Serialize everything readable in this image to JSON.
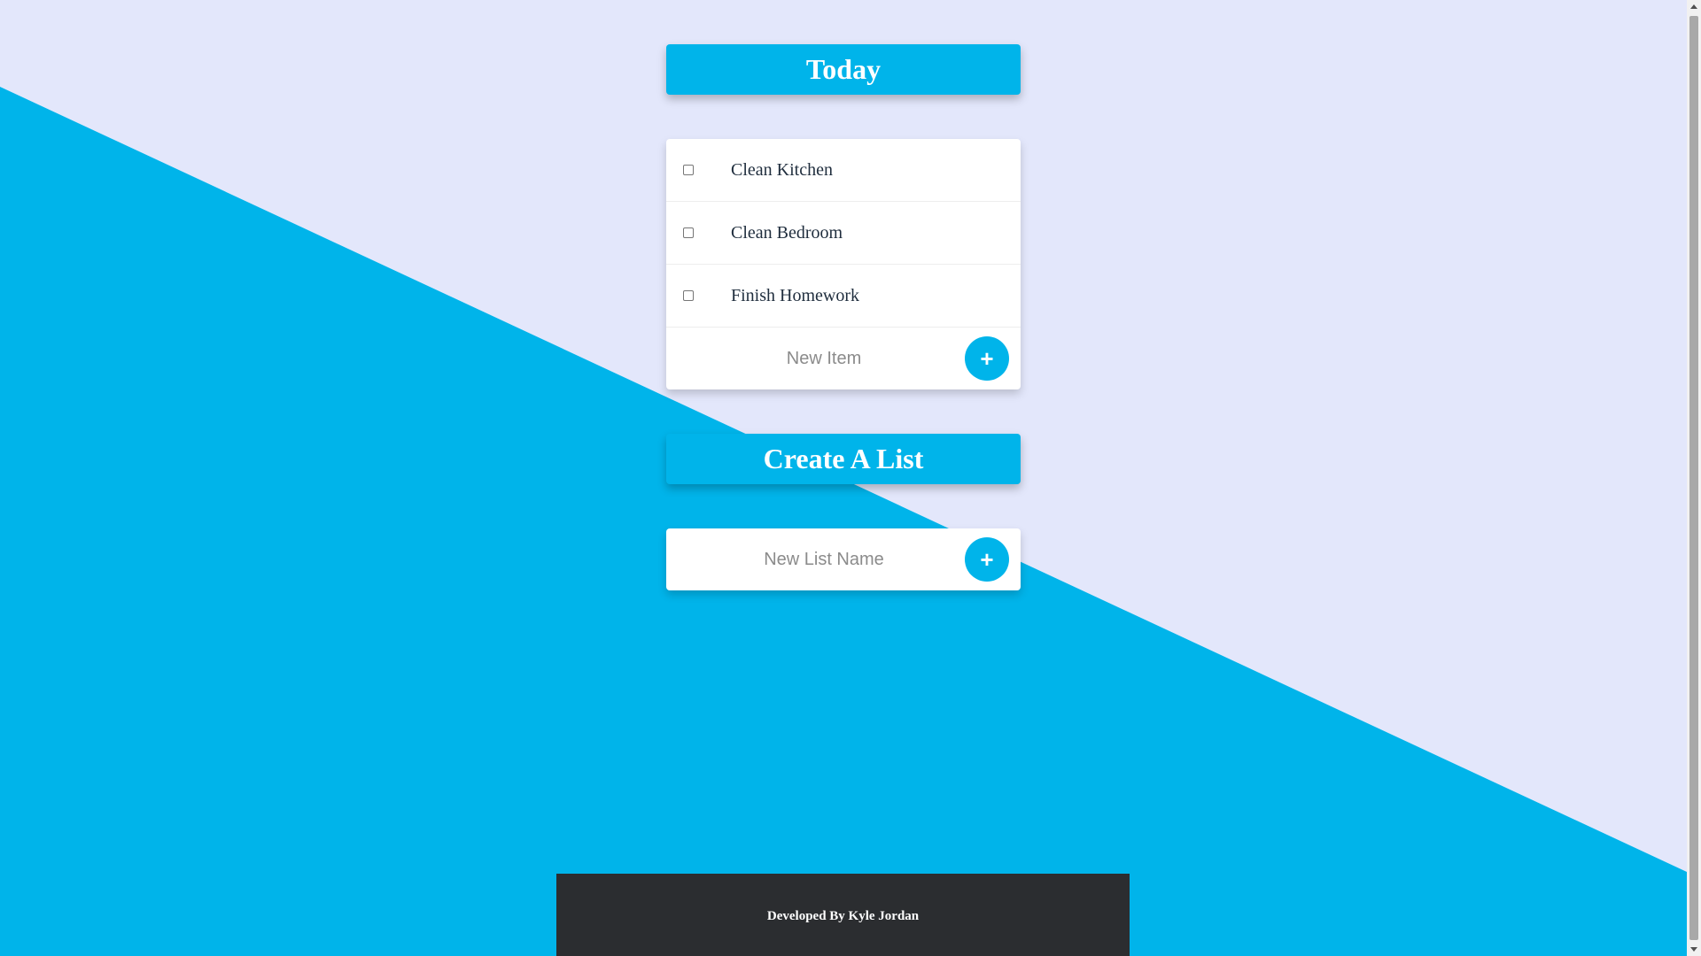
{
  "colors": {
    "accent": "#00b4ea",
    "background": "#e3e7fb",
    "footer": "#2b2d30"
  },
  "today_list": {
    "title": "Today",
    "items": [
      {
        "label": "Clean Kitchen",
        "checked": false
      },
      {
        "label": "Clean Bedroom",
        "checked": false
      },
      {
        "label": "Finish Homework",
        "checked": false
      }
    ],
    "new_item_placeholder": "New Item",
    "add_label": "+"
  },
  "create_list": {
    "title": "Create A List",
    "new_list_placeholder": "New List Name",
    "add_label": "+"
  },
  "footer": {
    "text": "Developed By Kyle Jordan"
  }
}
